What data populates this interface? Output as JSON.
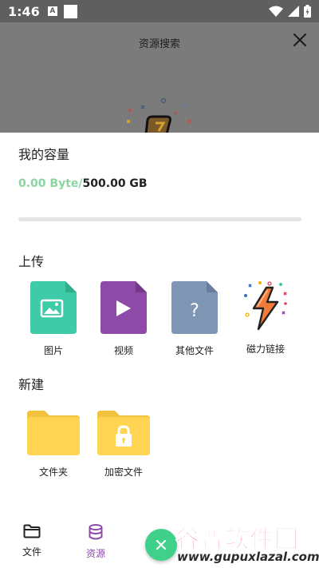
{
  "status_bar": {
    "time": "1:46",
    "notif_letter": "A"
  },
  "background": {
    "title": "资源搜索"
  },
  "capacity": {
    "title": "我的容量",
    "used": "0.00 Byte",
    "separator": "/",
    "total": "500.00 GB",
    "used_fraction": 0.0
  },
  "upload": {
    "title": "上传",
    "items": [
      {
        "label": "图片",
        "icon": "image-file-icon",
        "color": "#3ecba8"
      },
      {
        "label": "视频",
        "icon": "video-file-icon",
        "color": "#8e4aa8"
      },
      {
        "label": "其他文件",
        "icon": "unknown-file-icon",
        "color": "#7e95b3",
        "glyph": "?"
      },
      {
        "label": "磁力链接",
        "icon": "magnet-link-icon",
        "color": "#f47a3a"
      }
    ]
  },
  "create": {
    "title": "新建",
    "items": [
      {
        "label": "文件夹",
        "icon": "folder-icon",
        "color": "#ffd452"
      },
      {
        "label": "加密文件",
        "icon": "locked-folder-icon",
        "color": "#ffd452"
      }
    ]
  },
  "bottom_nav": {
    "items": [
      {
        "label": "文件",
        "icon": "folder-outline-icon",
        "active": false,
        "color": "#222222"
      },
      {
        "label": "资源",
        "icon": "database-icon",
        "active": true,
        "color": "#8e4aa8"
      }
    ],
    "fab_icon": "close-icon"
  },
  "watermark": {
    "title": "谷普软件园",
    "url": "www.gupuxlazal.com"
  }
}
